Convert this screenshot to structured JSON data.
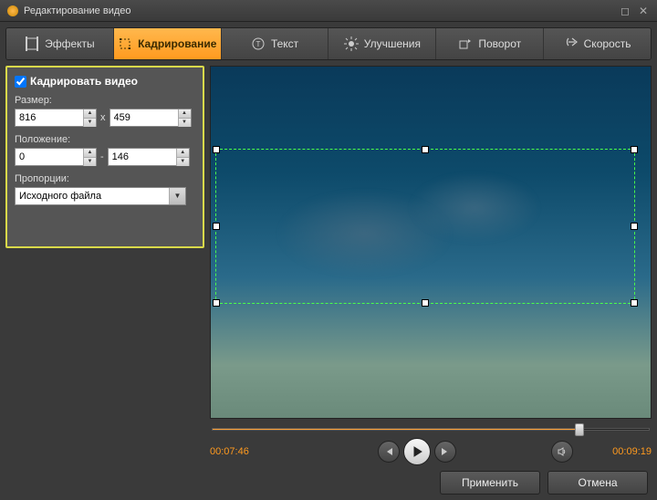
{
  "window": {
    "title": "Редактирование видео"
  },
  "tabs": {
    "effects": "Эффекты",
    "crop": "Кадрирование",
    "text": "Текст",
    "enhance": "Улучшения",
    "rotate": "Поворот",
    "speed": "Скорость"
  },
  "sidebar": {
    "chk_label": "Кадрировать видео",
    "size_label": "Размер:",
    "size_w": "816",
    "size_h": "459",
    "x_sep": "x",
    "pos_label": "Положение:",
    "pos_x": "0",
    "pos_y": "146",
    "dash": "-",
    "ratio_label": "Пропорции:",
    "ratio_value": "Исходного файла"
  },
  "player": {
    "current_time": "00:07:46",
    "total_time": "00:09:19"
  },
  "footer": {
    "apply": "Применить",
    "cancel": "Отмена"
  }
}
